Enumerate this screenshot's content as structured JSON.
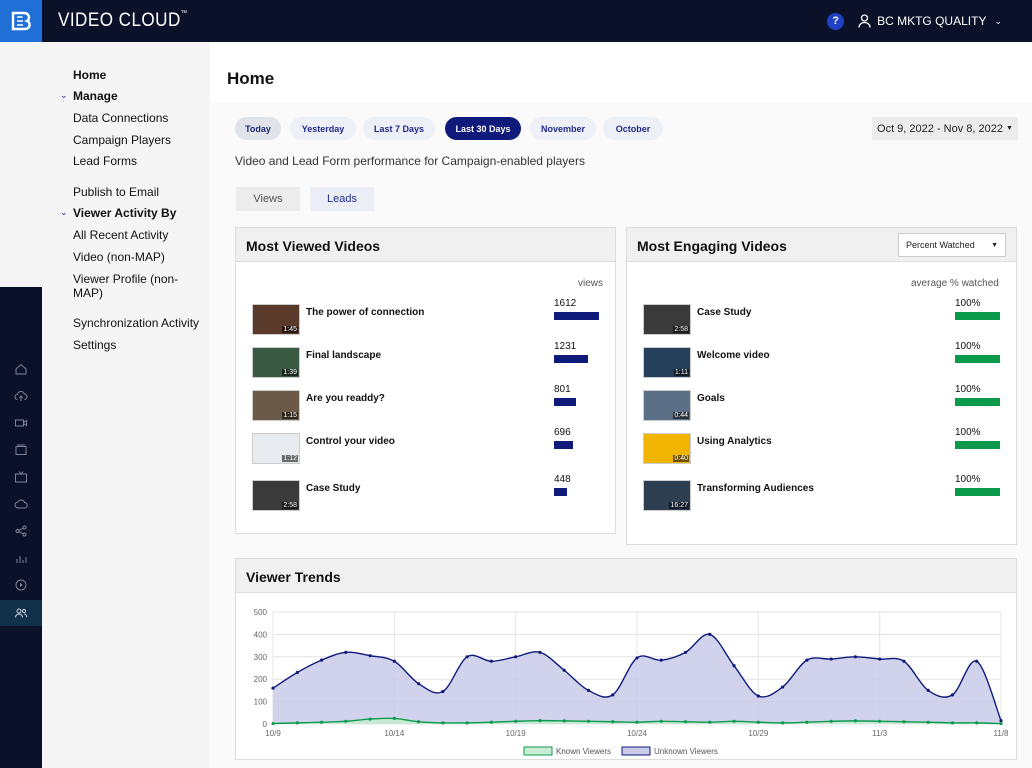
{
  "app": {
    "brand": "VIDEO CLOUD",
    "tm": "™",
    "help": "?",
    "user": "BC MKTG QUALITY"
  },
  "nav": {
    "home": "Home",
    "manage": "Manage",
    "data_connections": "Data Connections",
    "campaign_players": "Campaign Players",
    "lead_forms": "Lead Forms",
    "publish_to_email": "Publish to Email",
    "viewer_activity_by": "Viewer Activity By",
    "all_recent_activity": "All Recent Activity",
    "video_non_map": "Video (non-MAP)",
    "viewer_profile_1": "Viewer Profile (non-",
    "viewer_profile_2": "MAP)",
    "sync_activity": "Synchronization Activity",
    "settings": "Settings"
  },
  "page": {
    "title": "Home",
    "pills": [
      "Today",
      "Yesterday",
      "Last 7 Days",
      "Last 30 Days",
      "November",
      "October"
    ],
    "date_range": "Oct 9, 2022 - Nov 8, 2022",
    "subtitle": "Video and Lead Form performance for Campaign-enabled players",
    "tab_views": "Views",
    "tab_leads": "Leads"
  },
  "most_viewed": {
    "title": "Most Viewed Videos",
    "column": "views",
    "max": 1612,
    "items": [
      {
        "title": "The power of connection",
        "value": 1612,
        "duration": "1:45"
      },
      {
        "title": "Final landscape",
        "value": 1231,
        "duration": "1:39"
      },
      {
        "title": "Are you readdy?",
        "value": 801,
        "duration": "1:15"
      },
      {
        "title": "Control your video",
        "value": 696,
        "duration": "1:12"
      },
      {
        "title": "Case Study",
        "value": 448,
        "duration": "2:58"
      }
    ]
  },
  "most_engaging": {
    "title": "Most Engaging Videos",
    "select": "Percent Watched",
    "column": "average % watched",
    "items": [
      {
        "title": "Case Study",
        "value": "100%",
        "pct": 100,
        "duration": "2:58"
      },
      {
        "title": "Welcome video",
        "value": "100%",
        "pct": 100,
        "duration": "1:11"
      },
      {
        "title": "Goals",
        "value": "100%",
        "pct": 100,
        "duration": "0:44"
      },
      {
        "title": "Using Analytics",
        "value": "100%",
        "pct": 100,
        "duration": "0:40"
      },
      {
        "title": "Transforming Audiences",
        "value": "100%",
        "pct": 100,
        "duration": "16:27"
      }
    ]
  },
  "chart_data": {
    "type": "area",
    "title": "Viewer Trends",
    "ylim": [
      0,
      500
    ],
    "yticks": [
      0,
      100,
      200,
      300,
      400,
      500
    ],
    "xticks": [
      "10/9",
      "10/14",
      "10/19",
      "10/24",
      "10/29",
      "11/3",
      "11/8"
    ],
    "x": [
      "10/9",
      "10/10",
      "10/11",
      "10/12",
      "10/13",
      "10/14",
      "10/15",
      "10/16",
      "10/17",
      "10/18",
      "10/19",
      "10/20",
      "10/21",
      "10/22",
      "10/23",
      "10/24",
      "10/25",
      "10/26",
      "10/27",
      "10/28",
      "10/29",
      "10/30",
      "10/31",
      "11/1",
      "11/2",
      "11/3",
      "11/4",
      "11/5",
      "11/6",
      "11/7",
      "11/8"
    ],
    "series": [
      {
        "name": "Known Viewers",
        "color": "#0b9a4c",
        "fill": "#c8ecd4",
        "values": [
          2,
          5,
          8,
          12,
          22,
          25,
          10,
          5,
          5,
          8,
          12,
          15,
          14,
          12,
          10,
          8,
          12,
          10,
          8,
          12,
          8,
          5,
          8,
          12,
          14,
          12,
          10,
          8,
          5,
          5,
          2
        ]
      },
      {
        "name": "Unknown Viewers",
        "color": "#0f1a7a",
        "fill": "#c9cbe9",
        "values": [
          160,
          230,
          285,
          320,
          305,
          280,
          180,
          145,
          300,
          280,
          300,
          320,
          240,
          150,
          130,
          295,
          285,
          320,
          400,
          260,
          125,
          165,
          285,
          290,
          300,
          290,
          280,
          150,
          130,
          280,
          15
        ]
      }
    ],
    "legend": "bottom-center"
  }
}
